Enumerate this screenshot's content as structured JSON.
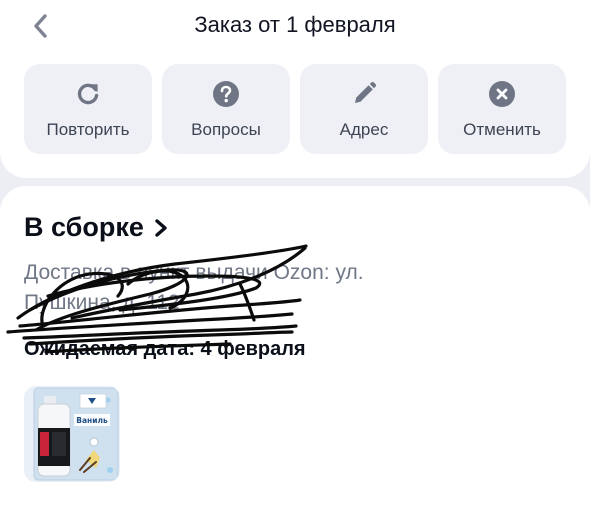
{
  "header": {
    "title": "Заказ от 1 февраля"
  },
  "actions": [
    {
      "label": "Повторить",
      "icon": "repeat-icon"
    },
    {
      "label": "Вопросы",
      "icon": "question-icon"
    },
    {
      "label": "Адрес",
      "icon": "pencil-icon"
    },
    {
      "label": "Отменить",
      "icon": "cancel-icon"
    }
  ],
  "order": {
    "status": "В сборке",
    "delivery_line1": "Доставка в пункт выдачи Ozon: ул.",
    "delivery_line2": "Пушкина, д. 112",
    "expected_date": "Ожидаемая дата: 4 февраля"
  },
  "product": {
    "image_label": "Ваниль"
  },
  "colors": {
    "icon": "#6f7585",
    "page_bg": "#eceef3",
    "button_bg": "#eef0f5",
    "secondary_text": "#707786"
  }
}
